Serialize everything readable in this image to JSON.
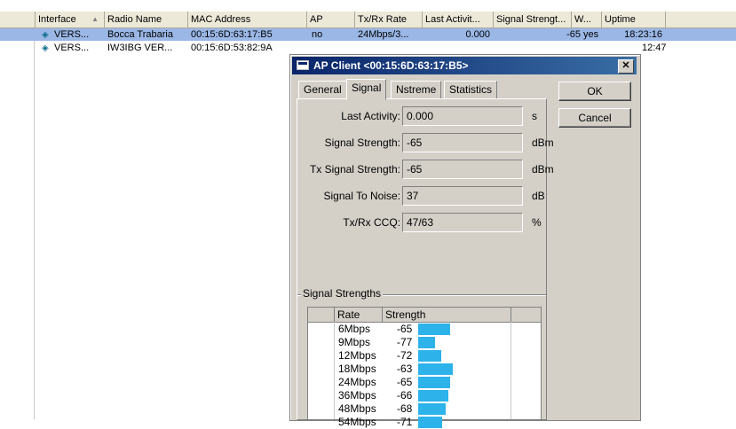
{
  "table": {
    "columns": [
      {
        "label": "Interface",
        "sort": "▲"
      },
      {
        "label": "Radio Name"
      },
      {
        "label": "MAC Address"
      },
      {
        "label": "AP"
      },
      {
        "label": "Tx/Rx Rate"
      },
      {
        "label": "Last Activit..."
      },
      {
        "label": "Signal Strengt..."
      },
      {
        "label": "W..."
      },
      {
        "label": "Uptime"
      }
    ],
    "rows": [
      {
        "interface": "VERS...",
        "radio_name": "Bocca Trabaria",
        "mac": "00:15:6D:63:17:B5",
        "ap": "no",
        "rate": "24Mbps/3...",
        "last_activity": "0.000",
        "signal": "-65",
        "w": "yes",
        "uptime": "18:23:16",
        "selected": true
      },
      {
        "interface": "VERS...",
        "radio_name": "IW3IBG VER...",
        "mac": "00:15:6D:53:82:9A",
        "ap": "",
        "rate": "",
        "last_activity": "",
        "signal": "",
        "w": "",
        "uptime": "12:47",
        "selected": false
      }
    ]
  },
  "dialog": {
    "title": "AP Client <00:15:6D:63:17:B5>",
    "close_glyph": "✕",
    "tabs": [
      {
        "label": "General",
        "active": false
      },
      {
        "label": "Signal",
        "active": true
      },
      {
        "label": "Nstreme",
        "active": false
      },
      {
        "label": "Statistics",
        "active": false
      }
    ],
    "fields": [
      {
        "label": "Last Activity:",
        "value": "0.000",
        "unit": "s"
      },
      {
        "label": "Signal Strength:",
        "value": "-65",
        "unit": "dBm"
      },
      {
        "label": "Tx Signal Strength:",
        "value": "-65",
        "unit": "dBm"
      },
      {
        "label": "Signal To Noise:",
        "value": "37",
        "unit": "dB"
      },
      {
        "label": "Tx/Rx CCQ:",
        "value": "47/63",
        "unit": "%"
      }
    ],
    "group_label": "Signal Strengths",
    "strength_table": {
      "columns": [
        "Rate",
        "Strength"
      ],
      "rows": [
        {
          "rate": "6Mbps",
          "strength": -65,
          "strength_label": "-65"
        },
        {
          "rate": "9Mbps",
          "strength": -77,
          "strength_label": "-77"
        },
        {
          "rate": "12Mbps",
          "strength": -72,
          "strength_label": "-72"
        },
        {
          "rate": "18Mbps",
          "strength": -63,
          "strength_label": "-63"
        },
        {
          "rate": "24Mbps",
          "strength": -65,
          "strength_label": "-65"
        },
        {
          "rate": "36Mbps",
          "strength": -66,
          "strength_label": "-66"
        },
        {
          "rate": "48Mbps",
          "strength": -68,
          "strength_label": "-68"
        },
        {
          "rate": "54Mbps",
          "strength": -71,
          "strength_label": "-71"
        }
      ],
      "bar_color": "#2db2ea"
    },
    "ok_label": "OK",
    "cancel_label": "Cancel"
  },
  "colors": {
    "selection": "#9ab7e6",
    "titlebar_start": "#0a246a",
    "titlebar_end": "#3a6ea5",
    "dialog_face": "#d4d0c8"
  }
}
